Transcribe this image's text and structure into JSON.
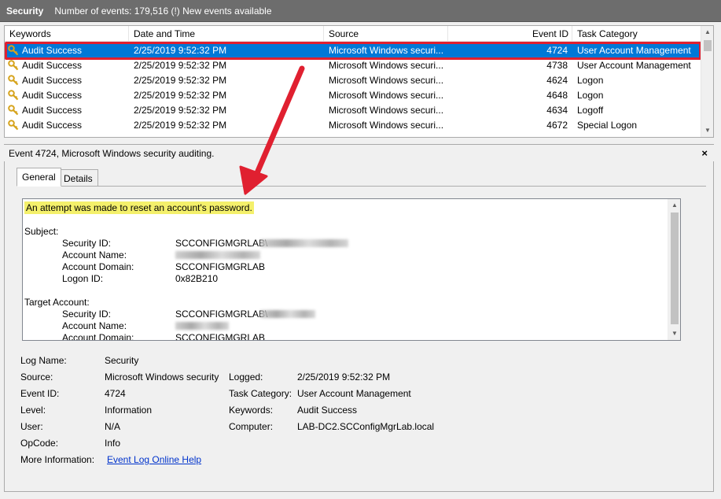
{
  "titlebar": {
    "log_name": "Security",
    "events_text": "Number of events: 179,516 (!) New events available"
  },
  "grid": {
    "columns": [
      "Keywords",
      "Date and Time",
      "Source",
      "Event ID",
      "Task Category"
    ],
    "rows": [
      {
        "keywords": "Audit Success",
        "datetime": "2/25/2019 9:52:32 PM",
        "source": "Microsoft Windows securi...",
        "event_id": "4724",
        "category": "User Account Management",
        "selected": true
      },
      {
        "keywords": "Audit Success",
        "datetime": "2/25/2019 9:52:32 PM",
        "source": "Microsoft Windows securi...",
        "event_id": "4738",
        "category": "User Account Management"
      },
      {
        "keywords": "Audit Success",
        "datetime": "2/25/2019 9:52:32 PM",
        "source": "Microsoft Windows securi...",
        "event_id": "4624",
        "category": "Logon"
      },
      {
        "keywords": "Audit Success",
        "datetime": "2/25/2019 9:52:32 PM",
        "source": "Microsoft Windows securi...",
        "event_id": "4648",
        "category": "Logon"
      },
      {
        "keywords": "Audit Success",
        "datetime": "2/25/2019 9:52:32 PM",
        "source": "Microsoft Windows securi...",
        "event_id": "4634",
        "category": "Logoff"
      },
      {
        "keywords": "Audit Success",
        "datetime": "2/25/2019 9:52:32 PM",
        "source": "Microsoft Windows securi...",
        "event_id": "4672",
        "category": "Special Logon"
      }
    ]
  },
  "detail": {
    "title": "Event 4724, Microsoft Windows security auditing.",
    "close": "×",
    "tabs": [
      {
        "label": "General",
        "active": true
      },
      {
        "label": "Details",
        "active": false
      }
    ],
    "message": {
      "headline": "An attempt was made to reset an account's password.",
      "subject_label": "Subject:",
      "subject": {
        "security_id_label": "Security ID:",
        "security_id_value": "SCCONFIGMGRLAB\\",
        "account_name_label": "Account Name:",
        "account_domain_label": "Account Domain:",
        "account_domain_value": "SCCONFIGMGRLAB",
        "logon_id_label": "Logon ID:",
        "logon_id_value": "0x82B210"
      },
      "target_label": "Target Account:",
      "target": {
        "security_id_label": "Security ID:",
        "security_id_value": "SCCONFIGMGRLAB\\",
        "account_name_label": "Account Name:",
        "account_domain_label": "Account Domain:",
        "account_domain_value": "SCCONFIGMGRLAB"
      }
    },
    "properties": {
      "log_name_label": "Log Name:",
      "log_name": "Security",
      "source_label": "Source:",
      "source": "Microsoft Windows security",
      "logged_label": "Logged:",
      "logged": "2/25/2019 9:52:32 PM",
      "event_id_label": "Event ID:",
      "event_id": "4724",
      "task_category_label": "Task Category:",
      "task_category": "User Account Management",
      "level_label": "Level:",
      "level": "Information",
      "keywords_label": "Keywords:",
      "keywords": "Audit Success",
      "user_label": "User:",
      "user": "N/A",
      "computer_label": "Computer:",
      "computer": "LAB-DC2.SCConfigMgrLab.local",
      "opcode_label": "OpCode:",
      "opcode": "Info",
      "more_info_label": "More Information:",
      "more_info_link": "Event Log Online Help"
    }
  },
  "colors": {
    "selection": "#0078d7",
    "annotation": "#e02030",
    "highlight": "#f4f06b",
    "link": "#0033cc"
  },
  "icons": [
    "key-icon",
    "chevron-up-icon",
    "chevron-down-icon",
    "close-icon"
  ]
}
